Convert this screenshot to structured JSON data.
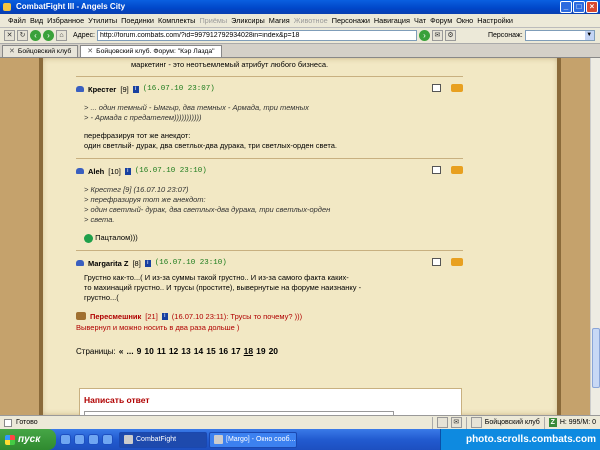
{
  "window": {
    "title": "CombatFight III - Angels City"
  },
  "menu": [
    {
      "label": "Файл",
      "disabled": false
    },
    {
      "label": "Вид",
      "disabled": false
    },
    {
      "label": "Избранное",
      "disabled": false
    },
    {
      "label": "Утилиты",
      "disabled": false
    },
    {
      "label": "Поединки",
      "disabled": false
    },
    {
      "label": "Комплекты",
      "disabled": false
    },
    {
      "label": "Приёмы",
      "disabled": true
    },
    {
      "label": "Эликсиры",
      "disabled": false
    },
    {
      "label": "Магия",
      "disabled": false
    },
    {
      "label": "Животное",
      "disabled": true
    },
    {
      "label": "Персонажи",
      "disabled": false
    },
    {
      "label": "Навигация",
      "disabled": false
    },
    {
      "label": "Чат",
      "disabled": false
    },
    {
      "label": "Форум",
      "disabled": false
    },
    {
      "label": "Окно",
      "disabled": false
    },
    {
      "label": "Настройки",
      "disabled": false
    }
  ],
  "address": {
    "label": "Адрес:",
    "url": "http://forum.combats.com/?id=997912792934028in=index&p=18",
    "person_label": "Персонаж:"
  },
  "tabs": [
    {
      "label": "Бойцовский клуб",
      "active": false
    },
    {
      "label": "Бойцовский клуб. Форум: \"Кэр Лазда\"",
      "active": true
    }
  ],
  "posts": {
    "top_text": "маркетинг - это неотъемлемый атрибут любого бизнеса.",
    "p1": {
      "user": "Крестег",
      "level": "[9]",
      "date": "(16.07.10 23:07)",
      "quote1": "> ... один темный - Ымгыр, два темных - Армада, три темных",
      "quote2": "> - Армада с предателем)))))))))))",
      "text1": "перефразируя тот же анекдот:",
      "text2": "один светлый- дурак, два светлых-два дурака, три светлых-орден света."
    },
    "p2": {
      "user": "Aleh",
      "level": "[10]",
      "date": "(16.07.10 23:10)",
      "quote1": "> Крестег [9] (16.07.10 23:07)",
      "quote2": "> перефразируя тот же анекдот:",
      "quote3": "> один светлый- дурак, два светлых-два дурака, три светлых-орден",
      "quote4": "> света.",
      "text1": "Пацталом)))"
    },
    "p3": {
      "user": "Margarita Z",
      "level": "[8]",
      "date": "(16.07.10 23:10)",
      "line1": "Грустно как-то...( И из-за суммы такой грустно.. И из-за самого факта каких-",
      "line2": "то махинаций грустно.. И трусы (простите), вывернутые на форуме наизнанку -",
      "line3": "грустно...("
    },
    "paladin": {
      "user": "Пересмешник",
      "level": "[21]",
      "note": "(16.07.10 23:11): Трусы то почему? )))",
      "text": "Вывернул и можно носить в два раза дольше )"
    }
  },
  "pagination": {
    "label": "Страницы:",
    "prev": "«",
    "ellipsis": "...",
    "pages": [
      "9",
      "10",
      "11",
      "12",
      "13",
      "14",
      "15",
      "16",
      "17",
      "18",
      "19",
      "20"
    ],
    "current": "18"
  },
  "reply": {
    "title": "Написать ответ"
  },
  "status": {
    "text": "Готово",
    "club": "Бойцовский клуб",
    "counter": "Н: 995/М: 0"
  },
  "taskbar": {
    "start": "пуск",
    "items": [
      {
        "label": "CombatFight",
        "active": true
      },
      {
        "label": "[Margo] - Окно сооб...",
        "active": false
      }
    ],
    "tray_text": "photo.scrolls.combats.com"
  }
}
